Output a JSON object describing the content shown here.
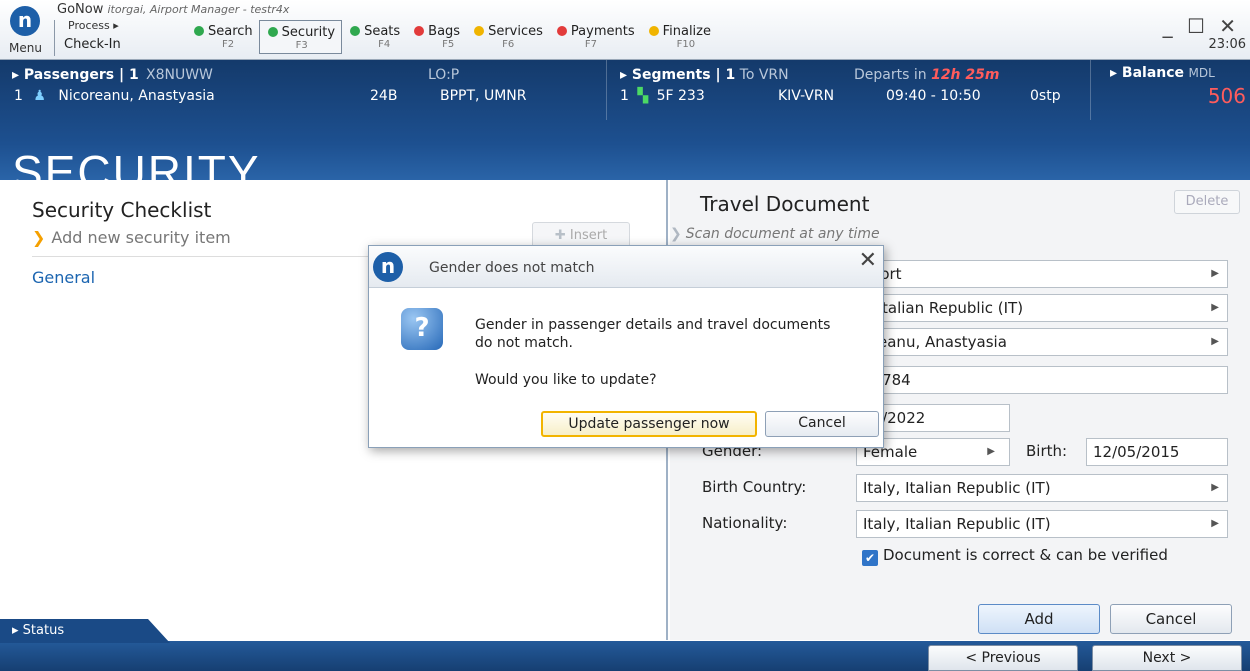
{
  "app": {
    "name": "GoNow",
    "subtitle": "itorgai, Airport Manager - testr4x",
    "logo_letter": "n",
    "menu_label": "Menu",
    "process_label": "Process ▸",
    "process_name": "Check-In",
    "clock": "23:06",
    "window_controls": "_ ☐ ✕"
  },
  "steps": [
    {
      "label": "Search",
      "fkey": "F2",
      "color": "#2fa84f"
    },
    {
      "label": "Security",
      "fkey": "F3",
      "color": "#2fa84f",
      "active": true
    },
    {
      "label": "Seats",
      "fkey": "F4",
      "color": "#2fa84f"
    },
    {
      "label": "Bags",
      "fkey": "F5",
      "color": "#e23b3b"
    },
    {
      "label": "Services",
      "fkey": "F6",
      "color": "#f0b400"
    },
    {
      "label": "Payments",
      "fkey": "F7",
      "color": "#e23b3b"
    },
    {
      "label": "Finalize",
      "fkey": "F10",
      "color": "#f0b400"
    }
  ],
  "passengers": {
    "header": "▸ Passengers | 1",
    "pnr": "X8NUWW",
    "lo": "LO:P",
    "row_index": "1",
    "name": "Nicoreanu, Anastyasia",
    "seat": "24B",
    "ssr": "BPPT, UMNR"
  },
  "segments": {
    "header": "▸ Segments | 1",
    "to": "To VRN",
    "departs_label": "Departs in",
    "departs_time": "12h 25m",
    "row_index": "1",
    "flight": "5F 233",
    "route": "KIV-VRN",
    "time": "09:40 - 10:50",
    "stops": "0stp"
  },
  "balance": {
    "header": "▸ Balance",
    "currency": "MDL",
    "amount": "506"
  },
  "page_title": "SECURITY",
  "checklist": {
    "title": "Security Checklist",
    "add_item": "Add new security item",
    "insert": "Insert",
    "general": "General"
  },
  "travel_doc": {
    "title": "Travel Document",
    "delete": "Delete",
    "scan_hint": "Scan document at any time",
    "doc_type": "sport",
    "issuing_country": "/, Italian Republic (IT)",
    "holder_name": "oreanu, Anastyasia",
    "doc_number": "68784",
    "expiry": "05/2022",
    "gender_label": "Gender:",
    "gender_value": "Female",
    "birth_label": "Birth:",
    "birth_value": "12/05/2015",
    "birth_country_label": "Birth Country:",
    "birth_country_value": "Italy, Italian Republic (IT)",
    "nationality_label": "Nationality:",
    "nationality_value": "Italy, Italian Republic (IT)",
    "verified_label": "Document is correct & can be verified",
    "add": "Add",
    "cancel": "Cancel"
  },
  "dialog": {
    "title": "Gender does not match",
    "message": "Gender in passenger details and travel documents do not match.",
    "question": "Would you like to update?",
    "update": "Update passenger now",
    "cancel": "Cancel"
  },
  "bottom": {
    "status": "Status",
    "previous": "< Previous",
    "next": "Next >"
  }
}
